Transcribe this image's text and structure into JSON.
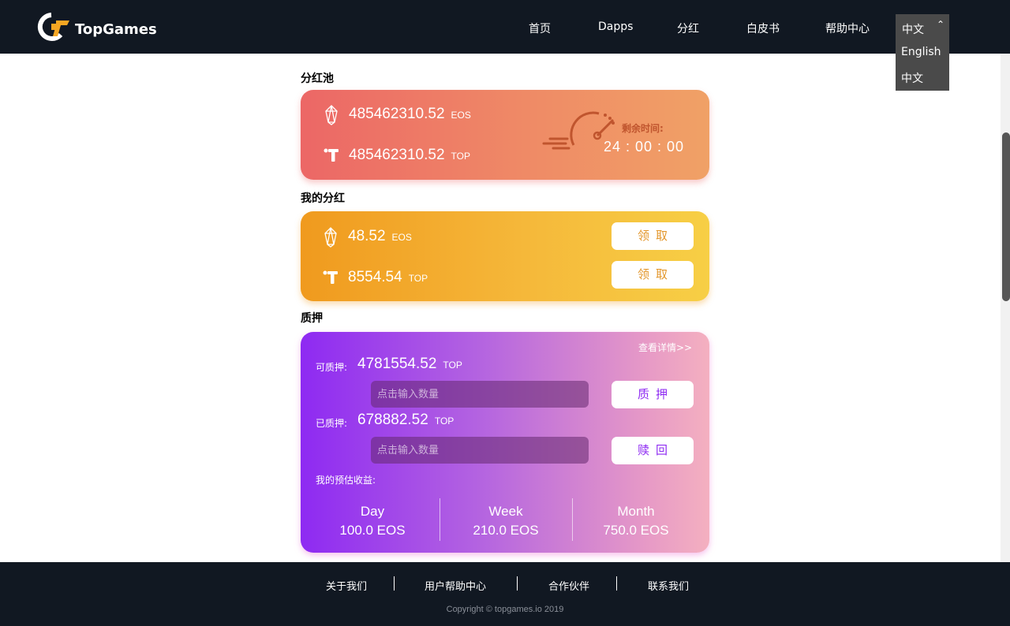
{
  "header": {
    "brand": "TopGames",
    "nav": [
      "首页",
      "Dapps",
      "分红",
      "白皮书",
      "帮助中心"
    ],
    "language": {
      "current": "中文",
      "options": [
        "English",
        "中文"
      ]
    }
  },
  "pool": {
    "title": "分红池",
    "eos_amount": "485462310.52",
    "eos_unit": "EOS",
    "top_amount": "485462310.52",
    "top_unit": "TOP",
    "remaining_label": "剩余时间:",
    "remaining_time": "24 : 00 : 00"
  },
  "dividend": {
    "title": "我的分红",
    "eos_amount": "48.52",
    "eos_unit": "EOS",
    "top_amount": "8554.54",
    "top_unit": "TOP",
    "claim_label": "领取"
  },
  "stake": {
    "title": "质押",
    "detail_link": "查看详情>>",
    "stakeable_label": "可质押:",
    "stakeable_amount": "4781554.52",
    "stakeable_unit": "TOP",
    "staked_label": "已质押:",
    "staked_amount": "678882.52",
    "staked_unit": "TOP",
    "input_placeholder": "点击输入数量",
    "stake_button": "质押",
    "redeem_button": "赎回",
    "earnings_label": "我的预估收益:",
    "earnings": [
      {
        "period": "Day",
        "value": "100.0 EOS"
      },
      {
        "period": "Week",
        "value": "210.0 EOS"
      },
      {
        "period": "Month",
        "value": "750.0 EOS"
      }
    ]
  },
  "footer": {
    "links": [
      "关于我们",
      "用户帮助中心",
      "合作伙伴",
      "联系我们"
    ],
    "copyright": "Copyright © topgames.io 2019"
  },
  "colors": {
    "header_bg": "#111822",
    "pool_start": "#ec6766",
    "pool_end": "#f0a166",
    "dividend_start": "#f09a1e",
    "dividend_end": "#f7cf45",
    "stake_start": "#8e2af2",
    "stake_end": "#f4b0c0"
  }
}
